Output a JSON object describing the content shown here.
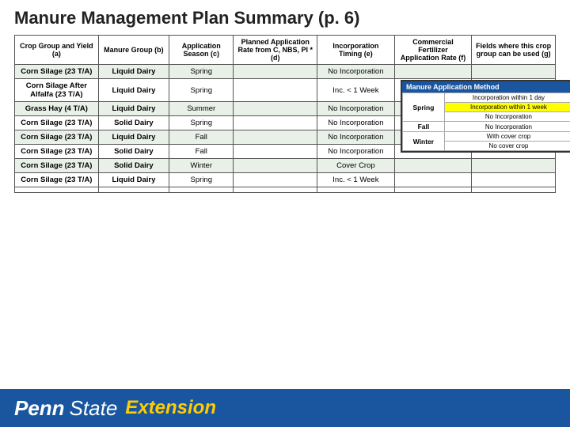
{
  "page": {
    "title": "Manure Management Plan Summary (p. 6)"
  },
  "table": {
    "headers": [
      "Crop Group and Yield (a)",
      "Manure Group (b)",
      "Application Season (c)",
      "Planned Application Rate from C, NBS, PI * (d)",
      "Incorporation Timing (e)",
      "Commercial Fertilizer Application Rate (f)",
      "Fields where this crop group can be used (g)"
    ],
    "rows": [
      {
        "crop": "Corn Silage (23 T/A)",
        "manure": "Liquid Dairy",
        "season": "Spring",
        "planned": "",
        "incorp": "No Incorporation",
        "commercial": "",
        "fields": ""
      },
      {
        "crop": "Corn Silage After Alfalfa (23 T/A)",
        "manure": "Liquid Dairy",
        "season": "Spring",
        "planned": "",
        "incorp": "Inc. < 1 Week",
        "commercial": "",
        "fields": ""
      },
      {
        "crop": "Grass Hay (4 T/A)",
        "manure": "Liquid Dairy",
        "season": "Summer",
        "planned": "",
        "incorp": "No Incorporation",
        "commercial": "",
        "fields": ""
      },
      {
        "crop": "Corn Silage (23 T/A)",
        "manure": "Solid Dairy",
        "season": "Spring",
        "planned": "",
        "incorp": "No Incorporation",
        "commercial": "",
        "fields": ""
      },
      {
        "crop": "Corn Silage (23 T/A)",
        "manure": "Liquid Dairy",
        "season": "Fall",
        "planned": "",
        "incorp": "No Incorporation",
        "commercial": "",
        "fields": ""
      },
      {
        "crop": "Corn Silage (23 T/A)",
        "manure": "Solid Dairy",
        "season": "Fall",
        "planned": "",
        "incorp": "No Incorporation",
        "commercial": "",
        "fields": ""
      },
      {
        "crop": "Corn Silage (23 T/A)",
        "manure": "Solid Dairy",
        "season": "Winter",
        "planned": "",
        "incorp": "Cover Crop",
        "commercial": "",
        "fields": ""
      },
      {
        "crop": "Corn Silage (23 T/A)",
        "manure": "Liquid Dairy",
        "season": "Spring",
        "planned": "",
        "incorp": "Inc. < 1 Week",
        "commercial": "",
        "fields": ""
      },
      {
        "crop": "",
        "manure": "",
        "season": "",
        "planned": "",
        "incorp": "",
        "commercial": "",
        "fields": ""
      }
    ]
  },
  "manure_method": {
    "title": "Manure Application Method",
    "seasons": [
      {
        "label": "Spring",
        "options": [
          {
            "text": "Incorporation within 1 day",
            "highlight": false
          },
          {
            "text": "Incorporation within 1 week",
            "highlight": true
          },
          {
            "text": "No Incorporation",
            "highlight": false
          }
        ]
      },
      {
        "label": "Fall",
        "options": [
          {
            "text": "No Incorporation",
            "highlight": false
          }
        ]
      },
      {
        "label": "Winter",
        "options": [
          {
            "text": "With cover crop",
            "highlight": false
          },
          {
            "text": "No cover crop",
            "highlight": false
          }
        ]
      }
    ]
  },
  "footer": {
    "penn": "Penn",
    "state": "State",
    "extension": "Extension"
  }
}
